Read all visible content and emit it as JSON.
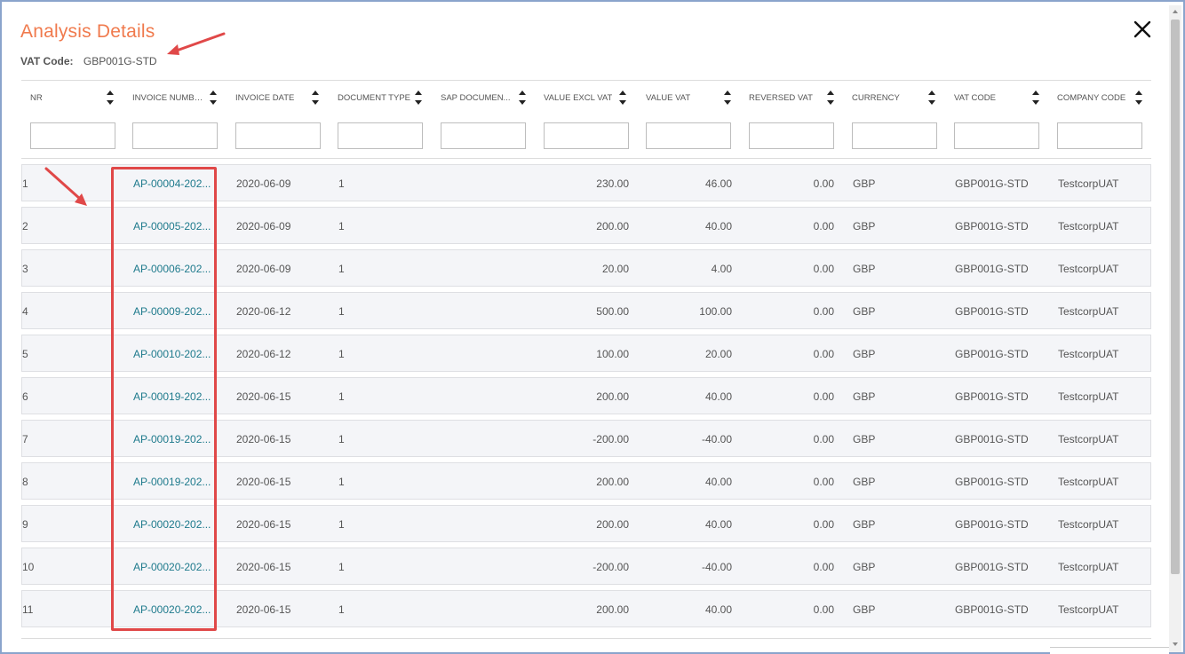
{
  "dialog": {
    "title": "Analysis Details",
    "vat_code_label": "VAT Code:",
    "vat_code_value": "GBP001G-STD"
  },
  "columns": [
    {
      "label": "NR"
    },
    {
      "label": "INVOICE NUMBER"
    },
    {
      "label": "INVOICE DATE"
    },
    {
      "label": "DOCUMENT TYPE"
    },
    {
      "label": "SAP DOCUMEN..."
    },
    {
      "label": "VALUE EXCL VAT"
    },
    {
      "label": "VALUE VAT"
    },
    {
      "label": "REVERSED VAT"
    },
    {
      "label": "CURRENCY"
    },
    {
      "label": "VAT CODE"
    },
    {
      "label": "COMPANY CODE"
    }
  ],
  "rows": [
    {
      "nr": "1",
      "invoice": "AP-00004-202...",
      "date": "2020-06-09",
      "doc_type": "1",
      "sap_doc": "",
      "excl": "230.00",
      "vat": "46.00",
      "rev": "0.00",
      "cur": "GBP",
      "code": "GBP001G-STD",
      "company": "TestcorpUAT"
    },
    {
      "nr": "2",
      "invoice": "AP-00005-202...",
      "date": "2020-06-09",
      "doc_type": "1",
      "sap_doc": "",
      "excl": "200.00",
      "vat": "40.00",
      "rev": "0.00",
      "cur": "GBP",
      "code": "GBP001G-STD",
      "company": "TestcorpUAT"
    },
    {
      "nr": "3",
      "invoice": "AP-00006-202...",
      "date": "2020-06-09",
      "doc_type": "1",
      "sap_doc": "",
      "excl": "20.00",
      "vat": "4.00",
      "rev": "0.00",
      "cur": "GBP",
      "code": "GBP001G-STD",
      "company": "TestcorpUAT"
    },
    {
      "nr": "4",
      "invoice": "AP-00009-202...",
      "date": "2020-06-12",
      "doc_type": "1",
      "sap_doc": "",
      "excl": "500.00",
      "vat": "100.00",
      "rev": "0.00",
      "cur": "GBP",
      "code": "GBP001G-STD",
      "company": "TestcorpUAT"
    },
    {
      "nr": "5",
      "invoice": "AP-00010-202...",
      "date": "2020-06-12",
      "doc_type": "1",
      "sap_doc": "",
      "excl": "100.00",
      "vat": "20.00",
      "rev": "0.00",
      "cur": "GBP",
      "code": "GBP001G-STD",
      "company": "TestcorpUAT"
    },
    {
      "nr": "6",
      "invoice": "AP-00019-202...",
      "date": "2020-06-15",
      "doc_type": "1",
      "sap_doc": "",
      "excl": "200.00",
      "vat": "40.00",
      "rev": "0.00",
      "cur": "GBP",
      "code": "GBP001G-STD",
      "company": "TestcorpUAT"
    },
    {
      "nr": "7",
      "invoice": "AP-00019-202...",
      "date": "2020-06-15",
      "doc_type": "1",
      "sap_doc": "",
      "excl": "-200.00",
      "vat": "-40.00",
      "rev": "0.00",
      "cur": "GBP",
      "code": "GBP001G-STD",
      "company": "TestcorpUAT"
    },
    {
      "nr": "8",
      "invoice": "AP-00019-202...",
      "date": "2020-06-15",
      "doc_type": "1",
      "sap_doc": "",
      "excl": "200.00",
      "vat": "40.00",
      "rev": "0.00",
      "cur": "GBP",
      "code": "GBP001G-STD",
      "company": "TestcorpUAT"
    },
    {
      "nr": "9",
      "invoice": "AP-00020-202...",
      "date": "2020-06-15",
      "doc_type": "1",
      "sap_doc": "",
      "excl": "200.00",
      "vat": "40.00",
      "rev": "0.00",
      "cur": "GBP",
      "code": "GBP001G-STD",
      "company": "TestcorpUAT"
    },
    {
      "nr": "10",
      "invoice": "AP-00020-202...",
      "date": "2020-06-15",
      "doc_type": "1",
      "sap_doc": "",
      "excl": "-200.00",
      "vat": "-40.00",
      "rev": "0.00",
      "cur": "GBP",
      "code": "GBP001G-STD",
      "company": "TestcorpUAT"
    },
    {
      "nr": "11",
      "invoice": "AP-00020-202...",
      "date": "2020-06-15",
      "doc_type": "1",
      "sap_doc": "",
      "excl": "200.00",
      "vat": "40.00",
      "rev": "0.00",
      "cur": "GBP",
      "code": "GBP001G-STD",
      "company": "TestcorpUAT"
    }
  ],
  "icons": {
    "close": "close-icon",
    "sort": "sort-icon"
  },
  "colors": {
    "title": "#f07a4d",
    "link": "#1e7a8c",
    "annotation": "#e04848",
    "row_bg": "#f4f5f8"
  }
}
